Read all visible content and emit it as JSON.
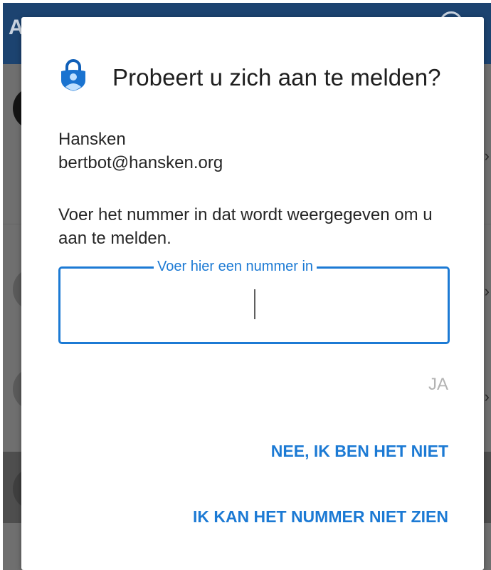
{
  "background": {
    "app_title_fragment": "A"
  },
  "dialog": {
    "title": "Probeert u zich aan te melden?",
    "icon": "authenticator-lock-person-icon",
    "account_name": "Hansken",
    "account_email": "bertbot@hansken.org",
    "instruction": "Voer het nummer in dat wordt weergegeven om u aan te melden.",
    "field": {
      "legend": "Voer hier een nummer in",
      "value": ""
    },
    "buttons": {
      "ja": "JA",
      "nee": "NEE, IK BEN HET NIET",
      "kan_niet_zien": "IK KAN HET NUMMER NIET ZIEN"
    }
  },
  "colors": {
    "accent": "#1c7ad4",
    "disabled": "#b3b3b3",
    "app_bar": "#1c4370",
    "scrim": "#6f6f6f"
  }
}
